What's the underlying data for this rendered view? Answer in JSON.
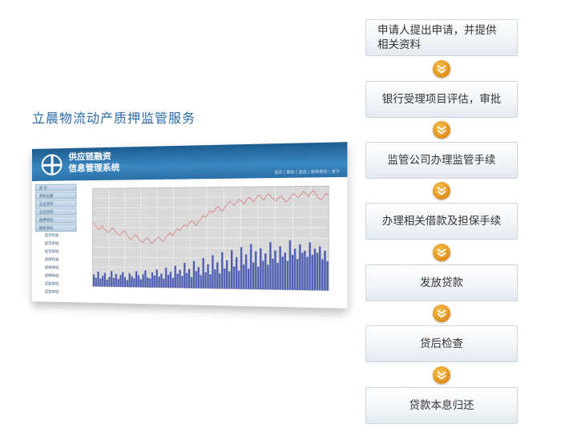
{
  "heading": "立晨物流动产质押监管服务",
  "screenshot": {
    "brand_line1": "供应链融资",
    "brand_line2": "信息管理系统",
    "header_links": "首页 | 帮助 | 退出 | 修改密码 | 关于",
    "menu": [
      {
        "label": "首 页",
        "type": "hl"
      },
      {
        "label": "系统设置",
        "type": "hl"
      },
      {
        "label": "企业资料",
        "type": "hl"
      },
      {
        "label": "企业资料",
        "type": "hl"
      },
      {
        "label": "质押资料",
        "type": "hl"
      },
      {
        "label": "融资资料",
        "type": "hl"
      },
      {
        "label": "提货列表",
        "type": "sub"
      },
      {
        "label": "提货审批",
        "type": "sub"
      },
      {
        "label": "提货审批",
        "type": "sub"
      },
      {
        "label": "质押列表",
        "type": "sub"
      },
      {
        "label": "质押审批",
        "type": "sub"
      },
      {
        "label": "质押审批",
        "type": "sub"
      },
      {
        "label": "还款审批",
        "type": "sub"
      },
      {
        "label": "还款审批",
        "type": "sub"
      }
    ]
  },
  "chart_data": {
    "type": "bar",
    "grid": true,
    "series": [
      {
        "kind": "line",
        "color": "#d98080",
        "values": [
          66,
          63,
          60,
          58,
          62,
          59,
          57,
          55,
          58,
          60,
          56,
          54,
          52,
          55,
          57,
          53,
          50,
          48,
          51,
          53,
          50,
          47,
          45,
          48,
          50,
          47,
          44,
          46,
          49,
          51,
          48,
          46,
          50,
          53,
          55,
          52,
          56,
          59,
          57,
          60,
          63,
          61,
          64,
          67,
          65,
          62,
          66,
          69,
          72,
          70,
          74,
          77,
          75,
          78,
          81,
          79,
          76,
          80,
          83,
          86,
          84,
          82,
          85,
          88,
          86,
          83,
          87,
          90,
          88,
          85,
          89,
          92,
          90,
          87,
          91,
          93,
          90,
          88,
          86,
          89,
          91,
          88,
          85,
          87,
          90,
          93,
          91,
          89,
          92,
          95,
          93,
          90,
          94,
          96,
          92,
          89,
          87,
          90,
          93,
          91
        ]
      },
      {
        "kind": "bar",
        "color": "#4a5bb0",
        "values": [
          12,
          9,
          15,
          8,
          11,
          14,
          7,
          10,
          16,
          9,
          13,
          8,
          12,
          15,
          10,
          7,
          14,
          11,
          9,
          16,
          12,
          8,
          13,
          17,
          10,
          9,
          15,
          12,
          18,
          11,
          14,
          9,
          20,
          13,
          16,
          10,
          22,
          14,
          18,
          12,
          25,
          15,
          19,
          11,
          27,
          17,
          21,
          13,
          30,
          16,
          24,
          14,
          33,
          19,
          26,
          15,
          36,
          20,
          28,
          17,
          38,
          22,
          31,
          18,
          41,
          24,
          34,
          20,
          44,
          26,
          37,
          22,
          40,
          28,
          35,
          24,
          46,
          30,
          38,
          26,
          42,
          32,
          36,
          28,
          48,
          34,
          40,
          30,
          44,
          36,
          38,
          32,
          46,
          34,
          40,
          36,
          42,
          30,
          38,
          28
        ]
      }
    ]
  },
  "steps": [
    "申请人提出申请，并提供相关资料",
    "银行受理项目评估，审批",
    "监管公司办理监管手续",
    "办理相关借款及担保手续",
    "发放贷款",
    "贷后检查",
    "贷款本息归还"
  ],
  "colors": {
    "heading": "#2a6aa8",
    "arrow": "#e08a18"
  }
}
